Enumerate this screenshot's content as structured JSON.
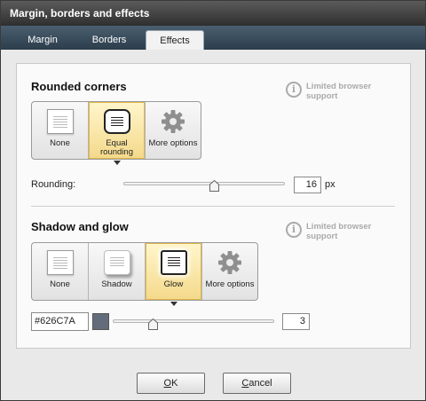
{
  "window": {
    "title": "Margin, borders and effects"
  },
  "tabs": [
    {
      "label": "Margin",
      "active": false
    },
    {
      "label": "Borders",
      "active": false
    },
    {
      "label": "Effects",
      "active": true
    }
  ],
  "rounded_corners": {
    "title": "Rounded corners",
    "info_text": "Limited browser support",
    "options": [
      {
        "label": "None",
        "icon": "plain-page-icon"
      },
      {
        "label": "Equal rounding",
        "icon": "rounded-page-icon",
        "selected": true
      },
      {
        "label": "More options",
        "icon": "gear-icon"
      }
    ],
    "rounding_label": "Rounding:",
    "rounding_value": "16",
    "rounding_unit": "px"
  },
  "shadow_glow": {
    "title": "Shadow and glow",
    "info_text": "Limited browser support",
    "options": [
      {
        "label": "None",
        "icon": "plain-page-icon"
      },
      {
        "label": "Shadow",
        "icon": "shadow-page-icon"
      },
      {
        "label": "Glow",
        "icon": "glow-page-icon",
        "selected": true
      },
      {
        "label": "More options",
        "icon": "gear-icon"
      }
    ],
    "color_value": "#626C7A",
    "swatch_color": "#626C7A",
    "size_value": "3"
  },
  "footer": {
    "ok_first": "O",
    "ok_rest": "K",
    "cancel_first": "C",
    "cancel_rest": "ancel"
  }
}
